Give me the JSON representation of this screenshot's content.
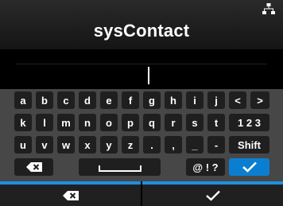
{
  "header": {
    "title": "sysContact",
    "network_icon": "network-icon"
  },
  "input": {
    "value": ""
  },
  "keyboard": {
    "rows": [
      [
        "a",
        "b",
        "c",
        "d",
        "e",
        "f",
        "g",
        "h",
        "i",
        "j",
        "<",
        ">"
      ],
      [
        "k",
        "l",
        "m",
        "n",
        "o",
        "p",
        "q",
        "r",
        "s",
        "t",
        "1 2 3"
      ],
      [
        "u",
        "v",
        "w",
        "x",
        "y",
        "z",
        ".",
        ",",
        "_",
        "-",
        "Shift"
      ]
    ],
    "symbols_label": "@ ! ?",
    "backspace_icon": "backspace-icon",
    "space_icon": "space-icon",
    "enter_icon": "checkmark-icon"
  },
  "footer": {
    "left_icon": "backspace-icon",
    "right_icon": "checkmark-icon"
  },
  "colors": {
    "accent": "#0a7fd1",
    "footer_accent": "#1e90e0",
    "key_bg": "#1f1f1f",
    "keyboard_bg": "#474747"
  }
}
